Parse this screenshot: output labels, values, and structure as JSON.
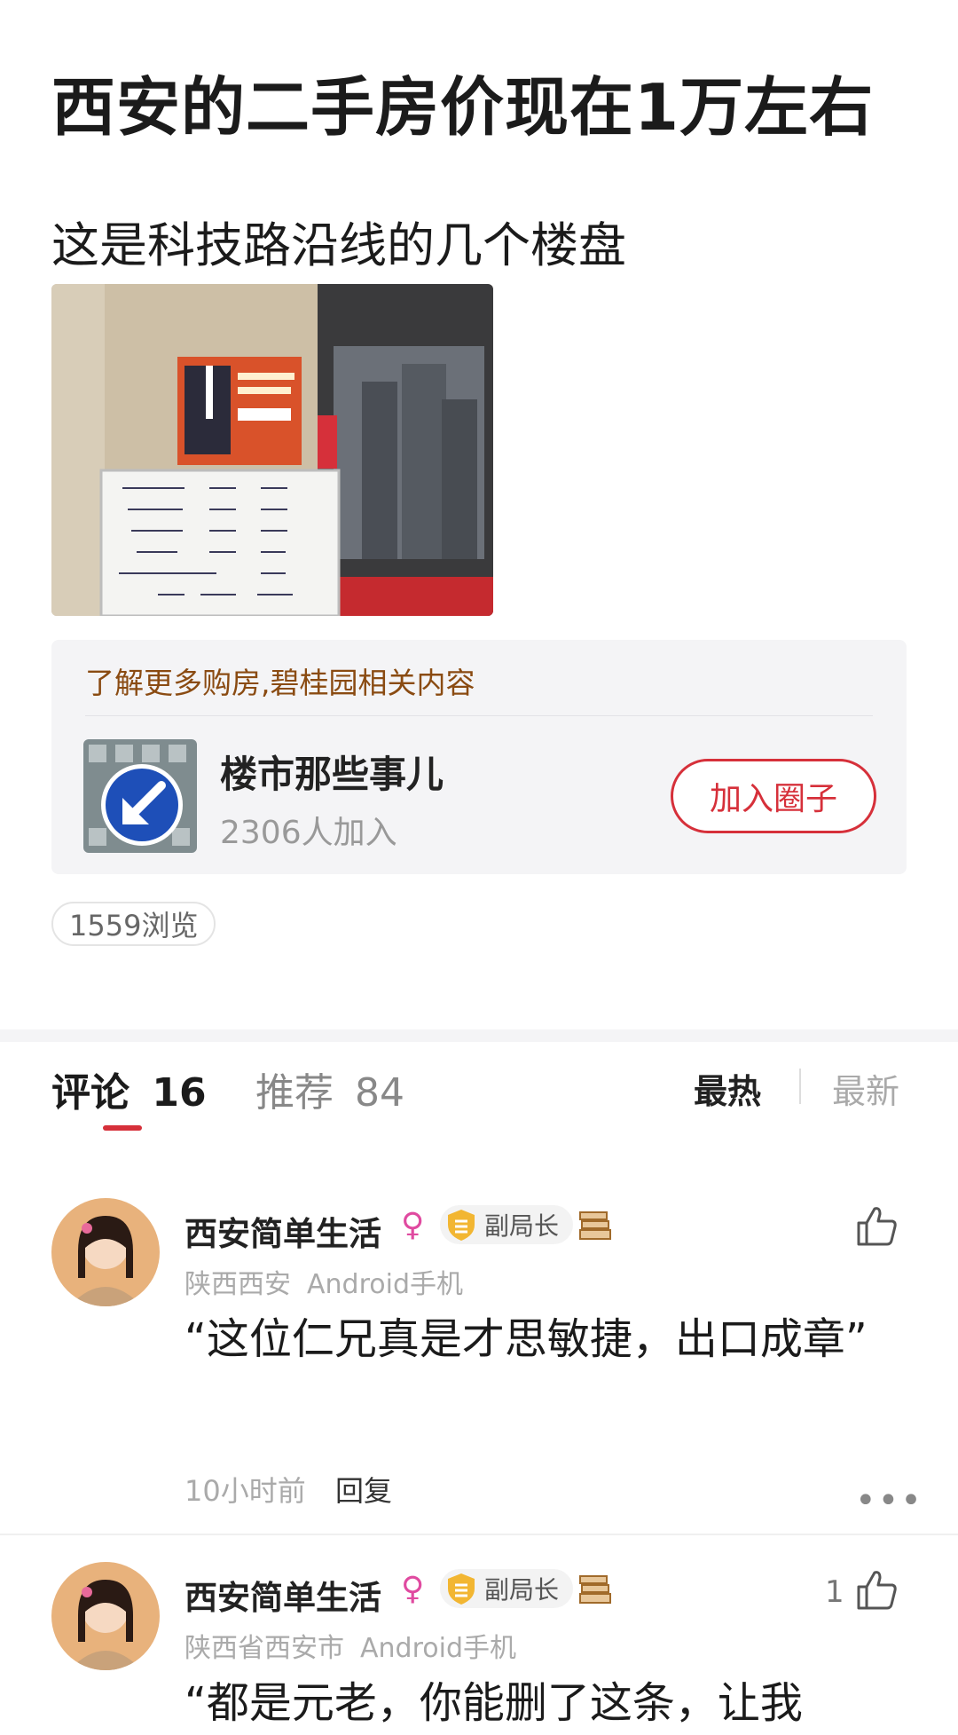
{
  "post": {
    "title": "西安的二手房价现在1万左右",
    "body": "这是科技路沿线的几个楼盘",
    "views": "1559浏览"
  },
  "related": {
    "title": "了解更多购房,碧桂园相关内容",
    "circle_name": "楼市那些事儿",
    "members": "2306人加入",
    "join_label": "加入圈子"
  },
  "tabs": {
    "comments_label": "评论",
    "comments_count": "16",
    "recommend_label": "推荐",
    "recommend_count": "84",
    "sort_hot": "最热",
    "sort_new": "最新"
  },
  "comments": [
    {
      "user": "西安简单生活",
      "gender": "♀",
      "badge": "副局长",
      "location": "陕西西安",
      "device": "Android手机",
      "text": "“这位仁兄真是才思敏捷，出口成章”",
      "time": "10小时前",
      "reply": "回复",
      "likes": "",
      "more": "•••"
    },
    {
      "user": "西安简单生活",
      "gender": "♀",
      "badge": "副局长",
      "location": "陕西省西安市",
      "device": "Android手机",
      "text": "“都是元老，你能删了这条，让我",
      "likes": "1"
    }
  ],
  "icons": {
    "like": "thumbs-up-icon",
    "gender": "female-icon",
    "badge": "shield-icon",
    "book": "books-icon"
  },
  "colors": {
    "accent": "#d6303a",
    "related_title": "#8a4b12",
    "female": "#e04aa0"
  }
}
